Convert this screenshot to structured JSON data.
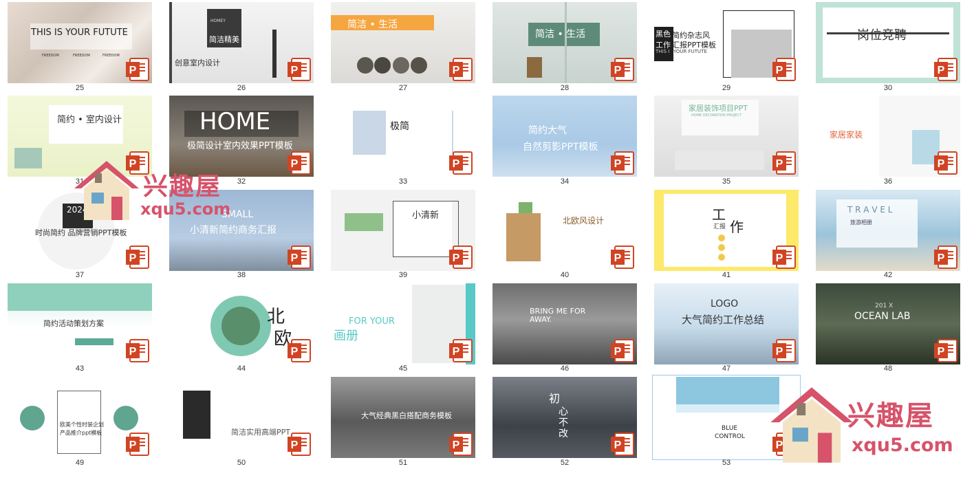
{
  "thumbnails": [
    {
      "number": "25",
      "texts": [
        "THIS IS YOUR FUTUTE",
        "FREEDOM",
        "FREEDOM",
        "FREEDOM"
      ]
    },
    {
      "number": "26",
      "texts": [
        "HOMEY",
        "简洁精美",
        "创意室内设计"
      ]
    },
    {
      "number": "27",
      "texts": [
        "简洁 • 生活"
      ]
    },
    {
      "number": "28",
      "texts": [
        "简洁 • 生活"
      ]
    },
    {
      "number": "29",
      "texts": [
        "黑色",
        "工作",
        "THIS I",
        "简约杂志风",
        "汇报PPT模板",
        "YOUR FUTUTE"
      ]
    },
    {
      "number": "30",
      "texts": [
        "岗位竞聘"
      ]
    },
    {
      "number": "31",
      "texts": [
        "简约 • 室内设计"
      ]
    },
    {
      "number": "32",
      "texts": [
        "HOME",
        "极简设计室内效果PPT模板"
      ]
    },
    {
      "number": "33",
      "texts": [
        "极简"
      ]
    },
    {
      "number": "34",
      "texts": [
        "简约大气",
        "自然剪影PPT模板"
      ]
    },
    {
      "number": "35",
      "texts": [
        "家居装饰项目PPT",
        "HOME DECORATION PROJECT"
      ]
    },
    {
      "number": "36",
      "texts": [
        "家居家装"
      ]
    },
    {
      "number": "37",
      "texts": [
        "2024",
        "时尚简约  品牌营销PPT模板"
      ]
    },
    {
      "number": "38",
      "texts": [
        "SMALL",
        "小清新简约商务汇报"
      ]
    },
    {
      "number": "39",
      "texts": [
        "小清新"
      ]
    },
    {
      "number": "40",
      "texts": [
        "北欧风设计"
      ]
    },
    {
      "number": "41",
      "texts": [
        "工",
        "作",
        "汇报"
      ]
    },
    {
      "number": "42",
      "texts": [
        "T R A V E L",
        "旅游相册"
      ]
    },
    {
      "number": "43",
      "texts": [
        "简约活动策划方案"
      ]
    },
    {
      "number": "44",
      "texts": [
        "北",
        "欧"
      ]
    },
    {
      "number": "45",
      "texts": [
        "FOR YOUR",
        "画册"
      ]
    },
    {
      "number": "46",
      "texts": [
        "BRING ME FOR",
        "AWAY."
      ]
    },
    {
      "number": "47",
      "texts": [
        "LOGO",
        "大气简约工作总结"
      ]
    },
    {
      "number": "48",
      "texts": [
        "201 X",
        "OCEAN LAB"
      ]
    },
    {
      "number": "49",
      "texts": [
        "欧美个性时装企划",
        "产品推介ppt模板"
      ]
    },
    {
      "number": "50",
      "texts": [
        "简洁实用高端PPT"
      ]
    },
    {
      "number": "51",
      "texts": [
        "大气经典黑白搭配商务模板"
      ]
    },
    {
      "number": "52",
      "texts": [
        "初",
        "心",
        "不",
        "改"
      ]
    },
    {
      "number": "53",
      "texts": [
        "BLUE",
        "CONTROL"
      ]
    }
  ],
  "watermarks": [
    {
      "brand": "兴趣屋",
      "domain": "xqu5.com"
    },
    {
      "brand": "兴趣屋",
      "domain": "xqu5.com"
    }
  ],
  "colors": {
    "ppt_icon": "#d04423",
    "selection": "#99c8f0"
  }
}
